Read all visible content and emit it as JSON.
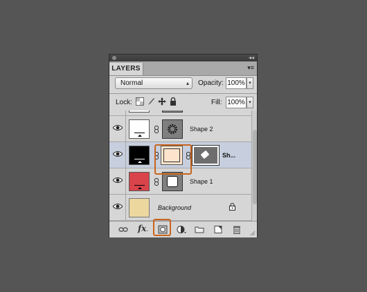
{
  "panel": {
    "tab_label": "LAYERS",
    "menu_glyph": "▾≡",
    "blend_mode": "Normal",
    "opacity_label": "Opacity:",
    "opacity_value": "100%",
    "lock_label": "Lock:",
    "fill_label": "Fill:",
    "fill_value": "100%"
  },
  "layers": [
    {
      "name": "Shape 2",
      "visible": true,
      "thumb_color": "#ffffff",
      "selected": false
    },
    {
      "name": "Sh...",
      "visible": true,
      "thumb_color": "#000000",
      "mask_color": "#fde3cb",
      "selected": true
    },
    {
      "name": "Shape 1",
      "visible": true,
      "thumb_color": "#d9434a",
      "selected": false
    },
    {
      "name": "Background",
      "visible": true,
      "thumb_color": "#ecd79f",
      "locked": true,
      "selected": false
    }
  ],
  "bottom_icons": [
    "link-layers-icon",
    "fx-icon",
    "add-mask-icon",
    "adjustment-layer-icon",
    "new-group-icon",
    "new-layer-icon",
    "trash-icon"
  ],
  "colors": {
    "highlight": "#c8641c",
    "selection": "#c7cfde",
    "panel_bg": "#d6d6d6"
  }
}
